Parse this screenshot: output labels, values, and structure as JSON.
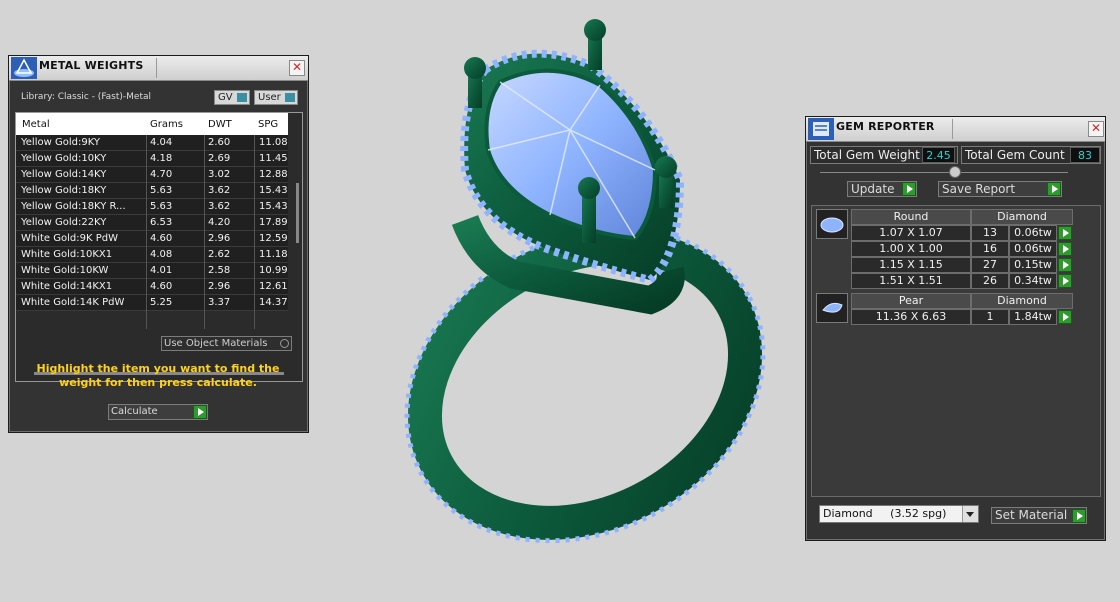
{
  "metal_weights": {
    "title": "METAL WEIGHTS",
    "library_label": "Library: Classic - (Fast)-Metal",
    "toggle_gv": "GV",
    "toggle_user": "User",
    "columns": [
      "Metal",
      "Grams",
      "DWT",
      "SPG"
    ],
    "rows": [
      {
        "metal": "Yellow Gold:9KY",
        "grams": "4.04",
        "dwt": "2.60",
        "spg": "11.08"
      },
      {
        "metal": "Yellow Gold:10KY",
        "grams": "4.18",
        "dwt": "2.69",
        "spg": "11.45"
      },
      {
        "metal": "Yellow Gold:14KY",
        "grams": "4.70",
        "dwt": "3.02",
        "spg": "12.88"
      },
      {
        "metal": "Yellow Gold:18KY",
        "grams": "5.63",
        "dwt": "3.62",
        "spg": "15.43"
      },
      {
        "metal": "Yellow Gold:18KY R...",
        "grams": "5.63",
        "dwt": "3.62",
        "spg": "15.43"
      },
      {
        "metal": "Yellow Gold:22KY",
        "grams": "6.53",
        "dwt": "4.20",
        "spg": "17.89"
      },
      {
        "metal": "White Gold:9K PdW",
        "grams": "4.60",
        "dwt": "2.96",
        "spg": "12.59"
      },
      {
        "metal": "White Gold:10KX1",
        "grams": "4.08",
        "dwt": "2.62",
        "spg": "11.18"
      },
      {
        "metal": "White Gold:10KW",
        "grams": "4.01",
        "dwt": "2.58",
        "spg": "10.99"
      },
      {
        "metal": "White Gold:14KX1",
        "grams": "4.60",
        "dwt": "2.96",
        "spg": "12.61"
      },
      {
        "metal": "White Gold:14K PdW",
        "grams": "5.25",
        "dwt": "3.37",
        "spg": "14.37"
      }
    ],
    "use_object_materials": "Use Object Materials",
    "instruction": "Highlight the item you want to find the weight for then press calculate.",
    "calculate_label": "Calculate"
  },
  "gem_reporter": {
    "title": "GEM REPORTER",
    "total_weight_label": "Total Gem Weight",
    "total_weight_value": "2.45",
    "total_count_label": "Total Gem Count",
    "total_count_value": "83",
    "update_label": "Update",
    "save_report_label": "Save Report",
    "groups": [
      {
        "shape": "Round",
        "material": "Diamond",
        "rows": [
          {
            "size": "1.07 X 1.07",
            "count": "13",
            "weight": "0.06tw"
          },
          {
            "size": "1.00 X 1.00",
            "count": "16",
            "weight": "0.06tw"
          },
          {
            "size": "1.15 X 1.15",
            "count": "27",
            "weight": "0.15tw"
          },
          {
            "size": "1.51 X 1.51",
            "count": "26",
            "weight": "0.34tw"
          }
        ]
      },
      {
        "shape": "Pear",
        "material": "Diamond",
        "rows": [
          {
            "size": "11.36 X 6.63",
            "count": "1",
            "weight": "1.84tw"
          }
        ]
      }
    ],
    "material_select": "Diamond     (3.52 spg)",
    "set_material_label": "Set Material"
  },
  "colors": {
    "panel_bg": "#333333",
    "value_cyan": "#27d3d3",
    "instruction_yellow": "#ffd21a",
    "arrow_green": "#2f9b2f",
    "ring_metal": "#0c5a3c",
    "gem_blue": "#8fb4ff"
  }
}
